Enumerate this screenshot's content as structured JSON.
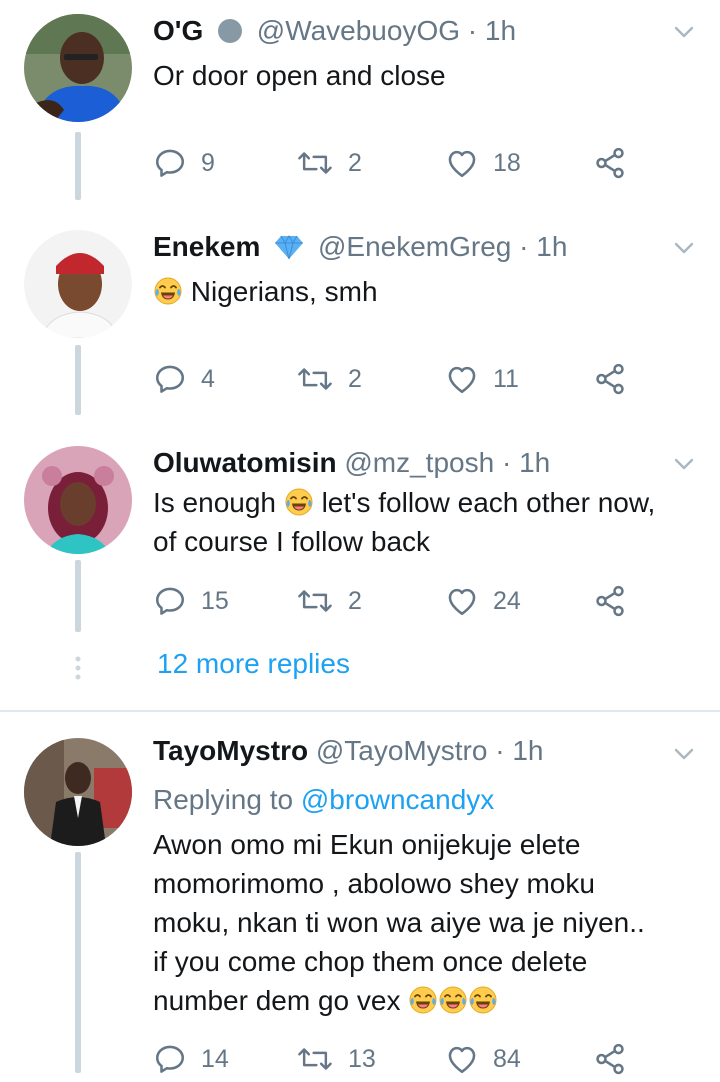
{
  "tweets": [
    {
      "name": "O'G",
      "handle": "@WavebuoyOG",
      "time": "· 1h",
      "text": "Or door open and close",
      "replies": "9",
      "retweets": "2",
      "likes": "18"
    },
    {
      "name": "Enekem",
      "handle": "@EnekemGreg",
      "time": "· 1h",
      "text": "Nigerians, smh",
      "replies": "4",
      "retweets": "2",
      "likes": "11"
    },
    {
      "name": "Oluwatomisin",
      "handle": "@mz_tposh",
      "time": "· 1h",
      "text_line1_a": "Is enough",
      "text_line1_b": "let's follow each other now,",
      "text_line2": "of course I follow back",
      "replies": "15",
      "retweets": "2",
      "likes": "24"
    },
    {
      "name": "TayoMystro",
      "handle": "@TayoMystro",
      "time": "· 1h",
      "replying_prefix": "Replying to",
      "replying_handle": "@browncandyx",
      "lines": [
        "Awon omo mi Ekun onijekuje elete",
        "momorimomo , abolowo shey moku",
        "moku, nkan ti won wa aiye wa je niyen..",
        "if you come chop them once delete",
        "number dem go vex"
      ],
      "replies": "14",
      "retweets": "13",
      "likes": "84"
    }
  ],
  "more_replies": "12 more replies",
  "colors": {
    "accent": "#1da1f2",
    "secondary": "#657786",
    "thread": "#ccd6dd"
  }
}
